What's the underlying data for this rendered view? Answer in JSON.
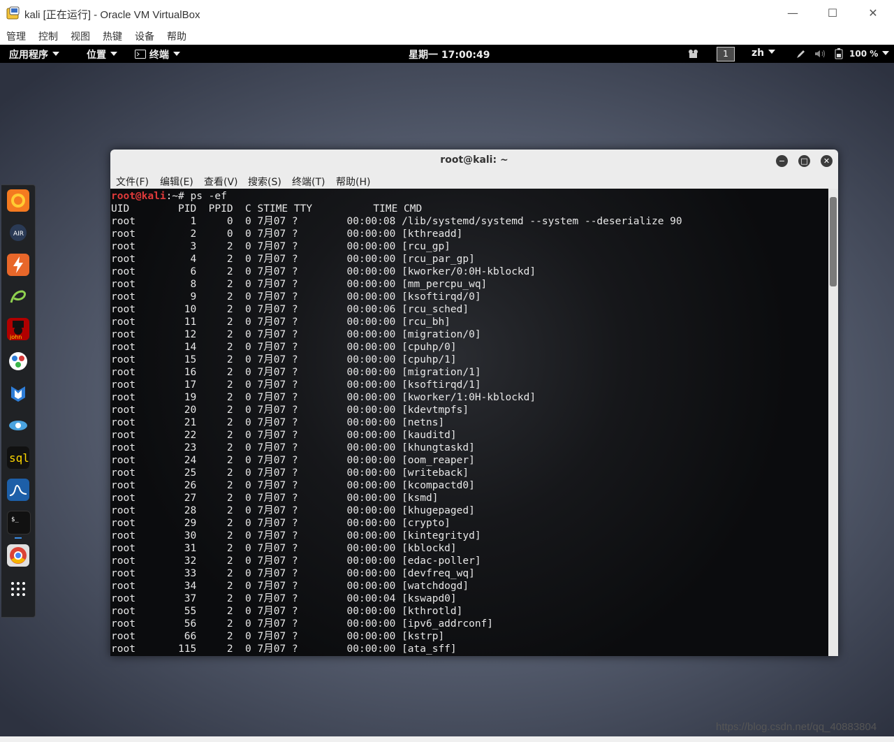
{
  "host": {
    "window_title": "kali [正在运行] - Oracle VM VirtualBox",
    "menu": [
      "管理",
      "控制",
      "视图",
      "热键",
      "设备",
      "帮助"
    ]
  },
  "kali_topbar": {
    "applications": "应用程序",
    "places": "位置",
    "terminal": "终端",
    "clock": "星期一 17:00:49",
    "workspace": "1",
    "language": "zh",
    "battery": "100 %"
  },
  "dock": {
    "items": [
      "firefox",
      "aircrack",
      "burpsuite",
      "sqlmap",
      "john",
      "maltego",
      "metasploit",
      "faraday",
      "cherrytree",
      "wireshark",
      "terminal",
      "chromium",
      "show-apps"
    ]
  },
  "terminal": {
    "title": "root@kali: ~",
    "menu": [
      "文件(F)",
      "编辑(E)",
      "查看(V)",
      "搜索(S)",
      "终端(T)",
      "帮助(H)"
    ],
    "prompt_user": "root@kali",
    "prompt_rest": ":~# ps -ef",
    "header": "UID        PID  PPID  C STIME TTY          TIME CMD",
    "lines": [
      "root         1     0  0 7月07 ?        00:00:08 /lib/systemd/systemd --system --deserialize 90",
      "root         2     0  0 7月07 ?        00:00:00 [kthreadd]",
      "root         3     2  0 7月07 ?        00:00:00 [rcu_gp]",
      "root         4     2  0 7月07 ?        00:00:00 [rcu_par_gp]",
      "root         6     2  0 7月07 ?        00:00:00 [kworker/0:0H-kblockd]",
      "root         8     2  0 7月07 ?        00:00:00 [mm_percpu_wq]",
      "root         9     2  0 7月07 ?        00:00:00 [ksoftirqd/0]",
      "root        10     2  0 7月07 ?        00:00:06 [rcu_sched]",
      "root        11     2  0 7月07 ?        00:00:00 [rcu_bh]",
      "root        12     2  0 7月07 ?        00:00:00 [migration/0]",
      "root        14     2  0 7月07 ?        00:00:00 [cpuhp/0]",
      "root        15     2  0 7月07 ?        00:00:00 [cpuhp/1]",
      "root        16     2  0 7月07 ?        00:00:00 [migration/1]",
      "root        17     2  0 7月07 ?        00:00:00 [ksoftirqd/1]",
      "root        19     2  0 7月07 ?        00:00:00 [kworker/1:0H-kblockd]",
      "root        20     2  0 7月07 ?        00:00:00 [kdevtmpfs]",
      "root        21     2  0 7月07 ?        00:00:00 [netns]",
      "root        22     2  0 7月07 ?        00:00:00 [kauditd]",
      "root        23     2  0 7月07 ?        00:00:00 [khungtaskd]",
      "root        24     2  0 7月07 ?        00:00:00 [oom_reaper]",
      "root        25     2  0 7月07 ?        00:00:00 [writeback]",
      "root        26     2  0 7月07 ?        00:00:00 [kcompactd0]",
      "root        27     2  0 7月07 ?        00:00:00 [ksmd]",
      "root        28     2  0 7月07 ?        00:00:00 [khugepaged]",
      "root        29     2  0 7月07 ?        00:00:00 [crypto]",
      "root        30     2  0 7月07 ?        00:00:00 [kintegrityd]",
      "root        31     2  0 7月07 ?        00:00:00 [kblockd]",
      "root        32     2  0 7月07 ?        00:00:00 [edac-poller]",
      "root        33     2  0 7月07 ?        00:00:00 [devfreq_wq]",
      "root        34     2  0 7月07 ?        00:00:00 [watchdogd]",
      "root        37     2  0 7月07 ?        00:00:04 [kswapd0]",
      "root        55     2  0 7月07 ?        00:00:00 [kthrotld]",
      "root        56     2  0 7月07 ?        00:00:00 [ipv6_addrconf]",
      "root        66     2  0 7月07 ?        00:00:00 [kstrp]",
      "root       115     2  0 7月07 ?        00:00:00 [ata_sff]"
    ]
  },
  "watermark": "https://blog.csdn.net/qq_40883804"
}
